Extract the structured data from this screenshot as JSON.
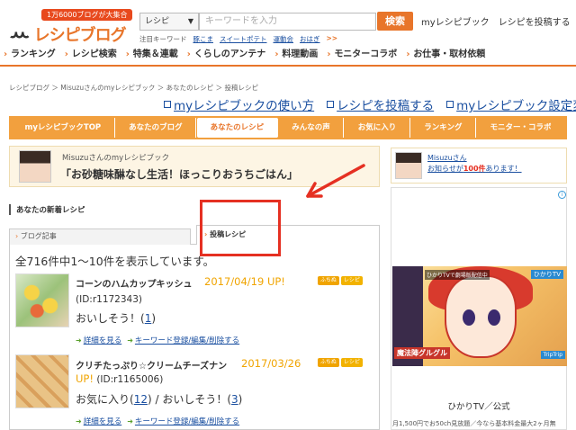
{
  "header": {
    "badge": "1万6000ブログが大集合",
    "logo_text": "レシピブログ",
    "search_category": "レシピ",
    "search_placeholder": "キーワードを入力",
    "search_button": "検索",
    "links": [
      "myレシピブック",
      "レシピを投稿する"
    ],
    "attention_label": "注目キーワード",
    "attention_keywords": [
      "豚こま",
      "スイートポテト",
      "運動会",
      "おはぎ"
    ],
    "attention_more": ">>"
  },
  "gnav": [
    "ランキング",
    "レシピ検索",
    "特集＆連載",
    "くらしのアンテナ",
    "料理動画",
    "モニターコラボ",
    "お仕事・取材依頼"
  ],
  "breadcrumb": "レシピブログ ＞ Misuzuさんのmyレシピブック ＞ あなたのレシピ ＞ 投稿レシピ",
  "top_links": [
    "myレシピブックの使い方",
    "レシピを投稿する",
    "myレシピブック設定変更"
  ],
  "tabs": [
    "myレシピブックTOP",
    "あなたのブログ",
    "あなたのレシピ",
    "みんなの声",
    "お気に入り",
    "ランキング",
    "モニター・コラボ"
  ],
  "active_tab": "あなたのレシピ",
  "profile": {
    "owner": "Misuzuさんのmyレシピブック",
    "title": "「お砂糖味醂なし生活！ほっこりおうちごはん」"
  },
  "section_title": "あなたの新着レシピ",
  "subtabs": {
    "blog": "ブログ記事",
    "recipe": "投稿レシピ"
  },
  "count_text": "全716件中1〜10件を表示しています。",
  "recipes": [
    {
      "title": "コーンのハムカップキッシュ",
      "date": "2017/04/19 UP!",
      "id": "(ID:r1172343)",
      "meta_prefix": "おいしそう！(",
      "meta_num": "1",
      "meta_suffix": ")",
      "actions": [
        "詳細を見る",
        "キーワード登録/編集/削除する"
      ]
    },
    {
      "title": "クリチたっぷり☆クリームチーズナン",
      "date": "2017/03/26",
      "date2": "UP!",
      "id": "(ID:r1165006)",
      "meta_prefix": "お気に入り(",
      "meta_num": "12",
      "meta_mid": ") / おいしそう！(",
      "meta_num2": "3",
      "meta_suffix": ")",
      "actions": [
        "詳細を見る",
        "キーワード登録/編集/削除する"
      ]
    }
  ],
  "recipe_badges": [
    "ふちぬ",
    "レシピ"
  ],
  "side": {
    "name": "Misuzuさん",
    "notice_prefix": "お知らせが",
    "notice_count": "100件",
    "notice_suffix": "あります！"
  },
  "ad": {
    "info": "i",
    "logo": "ひかりTV",
    "caption": "ひかりTVで劇場版配信中",
    "cap_title": "魔法陣グルグル",
    "cap_tag": "TripTrip",
    "brand": "ひかりTV／公式",
    "desc": "月1,500円でお50ch見放題／今なら基本料金最大2ヶ月無"
  },
  "colors": {
    "accent": "#e8752a",
    "tab_bg": "#f2a03e",
    "link": "#1a4fa0",
    "date": "#f0a400",
    "annotation": "#e53022"
  }
}
